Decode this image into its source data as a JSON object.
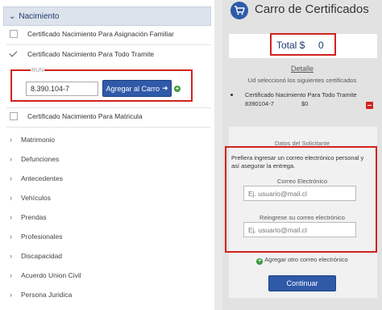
{
  "left": {
    "section_title": "Nacimiento",
    "options": [
      {
        "label": "Certificado Nacimiento Para Asignación Familiar",
        "checked": false
      },
      {
        "label": "Certificado Nacimiento Para Todo Tramite",
        "checked": true
      },
      {
        "label": "Certificado Nacimiento Para Matricula",
        "checked": false
      }
    ],
    "rut_label": "RUN",
    "rut_value": "8.390.104-7",
    "add_cart_label": "Agregar al Carro",
    "categories": [
      "Matrimonio",
      "Defunciones",
      "Antecedentes",
      "Vehículos",
      "Prendas",
      "Profesionales",
      "Discapacidad",
      "Acuerdo Union Civil",
      "Persona Juridica"
    ]
  },
  "cart": {
    "title": "Carro de Certificados",
    "total_label": "Total $",
    "total_value": "0",
    "detail_link": "Detalle",
    "selected_text": "Ud seleccionó los siguientes certificados",
    "item": {
      "name": "Certificado Nacimiento Para Todo Tramite",
      "rut": "8390104-7",
      "price": "$0"
    }
  },
  "applicant": {
    "title": "Datos del Solicitante",
    "description": "Prefiera ingresar un correo electrónico personal y así asegurar la entrega.",
    "email_label": "Correo Electrónico",
    "email_placeholder": "Ej. usuario@mail.cl",
    "email2_label": "Reingrese su correo electrónico",
    "email2_placeholder": "Ej. usuario@mail.cl",
    "add_email_label": "Agregar otro correo electrónico",
    "continue_label": "Continuar"
  },
  "colors": {
    "accent": "#2f5aa8",
    "highlight": "#d0231f",
    "add_green": "#3a9a3a"
  }
}
